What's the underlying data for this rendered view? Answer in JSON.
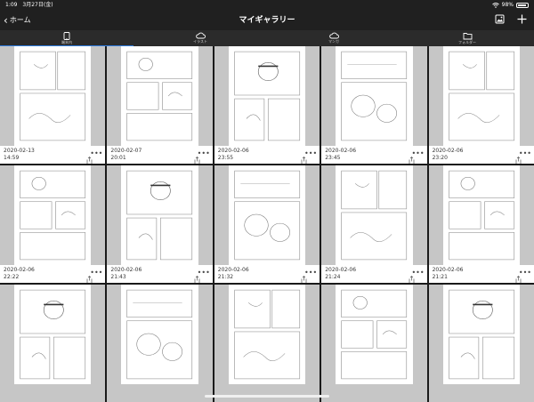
{
  "status_bar": {
    "time": "1:09",
    "date": "3月27日(金)",
    "battery": "98%"
  },
  "nav": {
    "back_label": "ホーム",
    "title": "マイギャラリー"
  },
  "tabs": [
    {
      "label": "端末内",
      "icon": "tablet-icon",
      "active": true
    },
    {
      "label": "イラスト",
      "icon": "cloud-icon",
      "active": false
    },
    {
      "label": "マンガ",
      "icon": "cloud-icon",
      "active": false
    },
    {
      "label": "フォルダー",
      "icon": "folder-icon",
      "active": false
    }
  ],
  "items": [
    {
      "date": "2020-02-13",
      "time": "14:59"
    },
    {
      "date": "2020-02-07",
      "time": "20:01"
    },
    {
      "date": "2020-02-06",
      "time": "23:55"
    },
    {
      "date": "2020-02-06",
      "time": "23:45"
    },
    {
      "date": "2020-02-06",
      "time": "23:20"
    },
    {
      "date": "2020-02-06",
      "time": "22:22"
    },
    {
      "date": "2020-02-06",
      "time": "21:43"
    },
    {
      "date": "2020-02-06",
      "time": "21:32"
    },
    {
      "date": "2020-02-06",
      "time": "21:24"
    },
    {
      "date": "2020-02-06",
      "time": "21:21"
    },
    {
      "date": "",
      "time": ""
    },
    {
      "date": "",
      "time": ""
    },
    {
      "date": "",
      "time": ""
    },
    {
      "date": "",
      "time": ""
    },
    {
      "date": "",
      "time": ""
    }
  ],
  "more_label": "•••"
}
